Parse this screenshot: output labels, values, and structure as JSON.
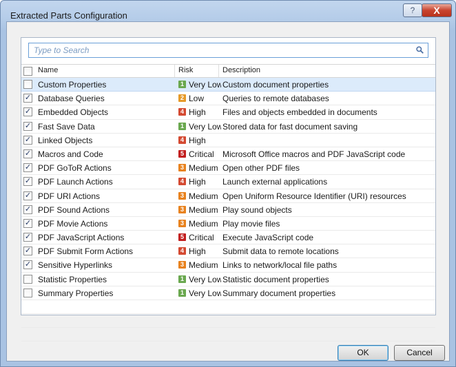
{
  "window": {
    "title": "Extracted Parts Configuration",
    "help_label": "?",
    "close_label": "X"
  },
  "search": {
    "placeholder": "Type to Search"
  },
  "columns": {
    "name": "Name",
    "risk": "Risk",
    "description": "Description"
  },
  "risk_colors": {
    "1": "#6aa84f",
    "2": "#e69a28",
    "3": "#e8821e",
    "4": "#d44a32",
    "5": "#c21f1f"
  },
  "rows": [
    {
      "checked": false,
      "name": "Custom Properties",
      "level": "1",
      "risk": "Very Low",
      "description": "Custom document properties"
    },
    {
      "checked": true,
      "name": "Database Queries",
      "level": "2",
      "risk": "Low",
      "description": "Queries to remote databases"
    },
    {
      "checked": true,
      "name": "Embedded Objects",
      "level": "4",
      "risk": "High",
      "description": "Files and objects embedded in documents"
    },
    {
      "checked": true,
      "name": "Fast Save Data",
      "level": "1",
      "risk": "Very Low",
      "description": "Stored data for fast document saving"
    },
    {
      "checked": true,
      "name": "Linked Objects",
      "level": "4",
      "risk": "High",
      "description": ""
    },
    {
      "checked": true,
      "name": "Macros and Code",
      "level": "5",
      "risk": "Critical",
      "description": "Microsoft Office macros and PDF JavaScript code"
    },
    {
      "checked": true,
      "name": "PDF GoToR Actions",
      "level": "3",
      "risk": "Medium",
      "description": "Open other PDF files"
    },
    {
      "checked": true,
      "name": "PDF Launch Actions",
      "level": "4",
      "risk": "High",
      "description": "Launch external applications"
    },
    {
      "checked": true,
      "name": "PDF URI Actions",
      "level": "3",
      "risk": "Medium",
      "description": "Open Uniform Resource Identifier (URI) resources"
    },
    {
      "checked": true,
      "name": "PDF Sound Actions",
      "level": "3",
      "risk": "Medium",
      "description": "Play sound objects"
    },
    {
      "checked": true,
      "name": "PDF Movie Actions",
      "level": "3",
      "risk": "Medium",
      "description": "Play movie files"
    },
    {
      "checked": true,
      "name": "PDF JavaScript Actions",
      "level": "5",
      "risk": "Critical",
      "description": "Execute JavaScript code"
    },
    {
      "checked": true,
      "name": "PDF Submit Form Actions",
      "level": "4",
      "risk": "High",
      "description": "Submit data to remote locations"
    },
    {
      "checked": true,
      "name": "Sensitive Hyperlinks",
      "level": "3",
      "risk": "Medium",
      "description": "Links to network/local file paths"
    },
    {
      "checked": false,
      "name": "Statistic Properties",
      "level": "1",
      "risk": "Very Low",
      "description": "Statistic document properties"
    },
    {
      "checked": false,
      "name": "Summary Properties",
      "level": "1",
      "risk": "Very Low",
      "description": "Summary document properties"
    }
  ],
  "buttons": {
    "ok": "OK",
    "cancel": "Cancel"
  }
}
